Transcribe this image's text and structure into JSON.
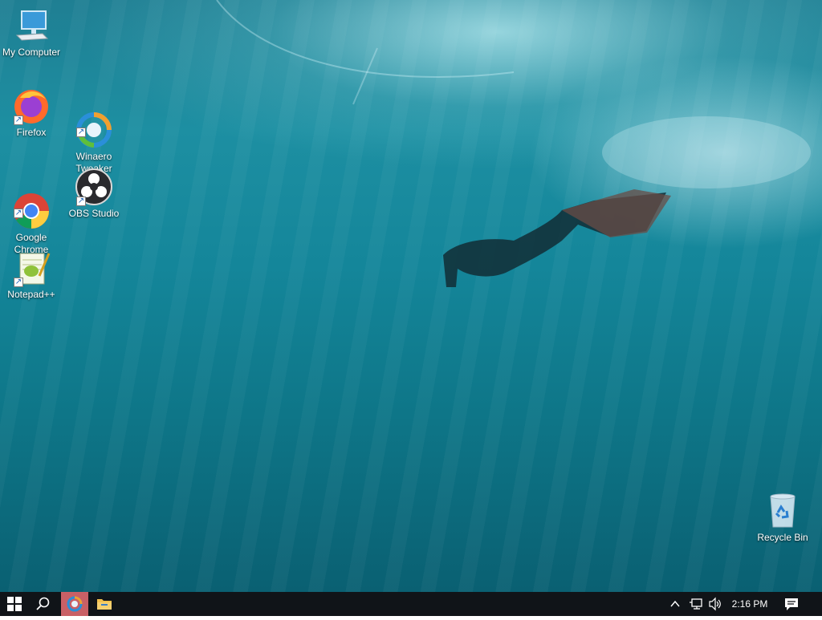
{
  "desktop": {
    "icons": [
      {
        "label": "My Computer",
        "icon": "computer-icon"
      },
      {
        "label": "Firefox",
        "icon": "firefox-icon"
      },
      {
        "label": "Winaero\nTweaker",
        "icon": "winaero-tweaker-icon"
      },
      {
        "label": "Google\nChrome",
        "icon": "chrome-icon"
      },
      {
        "label": "OBS Studio",
        "icon": "obs-studio-icon"
      },
      {
        "label": "Notepad++",
        "icon": "notepadpp-icon"
      },
      {
        "label": "Recycle Bin",
        "icon": "recycle-bin-icon"
      }
    ],
    "wallpaper": "underwater snorkeler"
  },
  "taskbar": {
    "start_icon": "windows-logo-icon",
    "search_icon": "search-icon",
    "pinned": [
      {
        "name": "winaero-tweaker-taskbar",
        "icon": "winaero-tweaker-icon",
        "active": true
      },
      {
        "name": "file-explorer-taskbar",
        "icon": "folder-icon",
        "active": false
      }
    ],
    "tray_icons": [
      "chevron-up-icon",
      "network-icon",
      "volume-icon"
    ],
    "clock": "2:16 PM",
    "notification_icon": "action-center-icon"
  },
  "colors": {
    "taskbar_bg": "#101418",
    "active_app_bg": "#c96066",
    "water": "#14869a"
  }
}
